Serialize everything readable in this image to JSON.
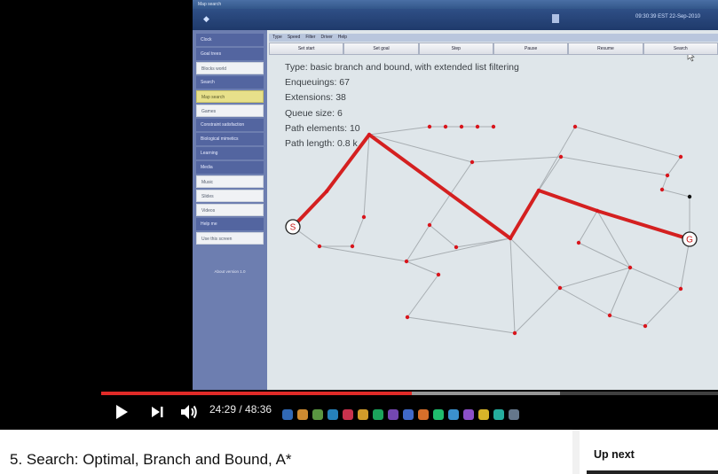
{
  "screen": {
    "window_title": "Map search",
    "clock": "09:30:39 EST 22-Sep-2010",
    "sidebar": [
      {
        "label": "Clock",
        "style": "dark"
      },
      {
        "label": "Goal trees",
        "style": "dark"
      },
      {
        "label": "Blocks world",
        "style": "light"
      },
      {
        "label": "Search",
        "style": "dark"
      },
      {
        "label": "Map search",
        "style": "yellow"
      },
      {
        "label": "Games",
        "style": "light"
      },
      {
        "label": "Constraint satisfaction",
        "style": "dark"
      },
      {
        "label": "Biological mimetics",
        "style": "dark"
      },
      {
        "label": "Learning",
        "style": "dark"
      },
      {
        "label": "Media",
        "style": "dark"
      },
      {
        "label": "Music",
        "style": "light"
      },
      {
        "label": "Slides",
        "style": "light"
      },
      {
        "label": "Videos",
        "style": "light"
      },
      {
        "label": "Help me",
        "style": "dark"
      },
      {
        "label": "Use this screen",
        "style": "light"
      }
    ],
    "about": "About version 1.0",
    "menu": [
      "Type",
      "Speed",
      "Filter",
      "Driver",
      "Help"
    ],
    "buttons": [
      "Set start",
      "Set goal",
      "Step",
      "Pause",
      "Resume",
      "Search"
    ],
    "info": {
      "type": "Type: basic branch and bound, with extended list filtering",
      "enqueuings": "Enqueuings: 67",
      "extensions": "Extensions: 38",
      "queue": "Queue size: 6",
      "path_elements": "Path elements: 10",
      "path_length": "Path length: 0.8 k"
    },
    "start_label": "S",
    "goal_label": "G",
    "colors": {
      "path": "#d42020",
      "edge": "#a8aeb2",
      "node": "#d8151c"
    }
  },
  "player": {
    "time": "24:29 / 48:36",
    "progress_played": 0.5038,
    "progress_buffered": 0.7445,
    "icons": [
      "play-icon",
      "next-icon",
      "volume-icon"
    ]
  },
  "page": {
    "video_title": "5. Search: Optimal, Branch and Bound, A*",
    "up_next": "Up next"
  }
}
